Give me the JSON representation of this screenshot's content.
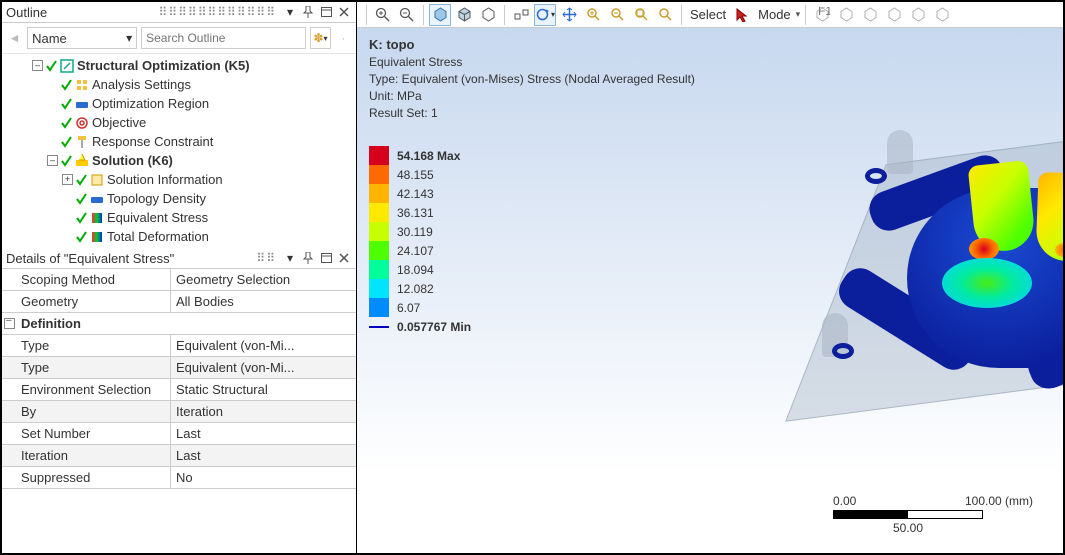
{
  "outline": {
    "title": "Outline",
    "name_label": "Name",
    "search_placeholder": "Search Outline",
    "nodes": {
      "root": "Structural Optimization (K5)",
      "analysis": "Analysis Settings",
      "region": "Optimization Region",
      "objective": "Objective",
      "response": "Response Constraint",
      "solution": "Solution (K6)",
      "solinfo": "Solution Information",
      "density": "Topology Density",
      "stress": "Equivalent Stress",
      "deform": "Total Deformation"
    }
  },
  "details": {
    "title": "Details of \"Equivalent Stress\"",
    "rows": {
      "scoping_label": "Scoping Method",
      "scoping_val": "Geometry Selection",
      "geom_label": "Geometry",
      "geom_val": "All Bodies",
      "def_label": "Definition",
      "type1_label": "Type",
      "type1_val": "Equivalent (von-Mi...",
      "type2_label": "Type",
      "type2_val": "Equivalent (von-Mi...",
      "env_label": "Environment Selection",
      "env_val": "Static Structural",
      "by_label": "By",
      "by_val": "Iteration",
      "set_label": "Set Number",
      "set_val": "Last",
      "iter_label": "Iteration",
      "iter_val": "Last",
      "supp_label": "Suppressed",
      "supp_val": "No"
    }
  },
  "toolbar": {
    "select": "Select",
    "mode": "Mode"
  },
  "info": {
    "title": "K: topo",
    "line1": "Equivalent Stress",
    "line2": "Type: Equivalent (von-Mises) Stress (Nodal Averaged Result)",
    "line3": "Unit: MPa",
    "line4": "Result Set: 1"
  },
  "legend": {
    "max": "54.168 Max",
    "v2": "48.155",
    "v3": "42.143",
    "v4": "36.131",
    "v5": "30.119",
    "v6": "24.107",
    "v7": "18.094",
    "v8": "12.082",
    "v9": "6.07",
    "min": "0.057767 Min",
    "colors": [
      "#d6001c",
      "#ff6a00",
      "#ffb400",
      "#ffe900",
      "#c8ff00",
      "#4dff00",
      "#00ff9a",
      "#00e4ff",
      "#008cff",
      "#0000c0"
    ]
  },
  "scale": {
    "t0": "0.00",
    "t1": "50.00",
    "t2": "100.00 (mm)"
  }
}
